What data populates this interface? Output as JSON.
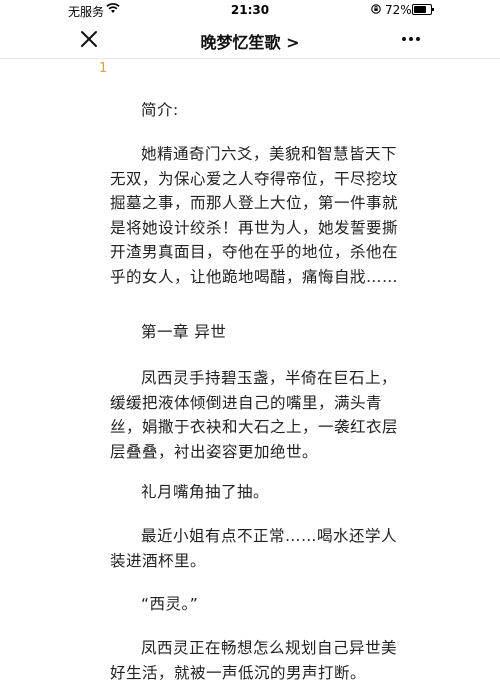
{
  "status_bar": {
    "carrier": "无服务",
    "time": "21:30",
    "battery": "72%",
    "battery_level": 0.72
  },
  "nav": {
    "title": "晚梦忆笙歌 >"
  },
  "page_number": "1",
  "article": {
    "intro_label": "简介:",
    "intro_text": "她精通奇门六爻，美貌和智慧皆天下无双，为保心爱之人夺得帝位，干尽挖坟掘墓之事，而那人登上大位，第一件事就是将她设计绞杀！再世为人，她发誓要撕开渣男真面目，夺他在乎的地位，杀他在乎的女人，让他跪地喝醋，痛悔自戕……",
    "chapter_title": "第一章 异世",
    "para1": "凤西灵手持碧玉盏，半倚在巨石上，缓缓把液体倾倒进自己的嘴里，满头青丝，娟撒于衣袂和大石之上，一袭红衣层层叠叠，衬出姿容更加绝世。",
    "para2": "礼月嘴角抽了抽。",
    "para3": "最近小姐有点不正常……喝水还学人装进酒杯里。",
    "para4": "“西灵。”",
    "para5": "凤西灵正在畅想怎么规划自己异世美好生活，就被一声低沉的男声打断。"
  }
}
